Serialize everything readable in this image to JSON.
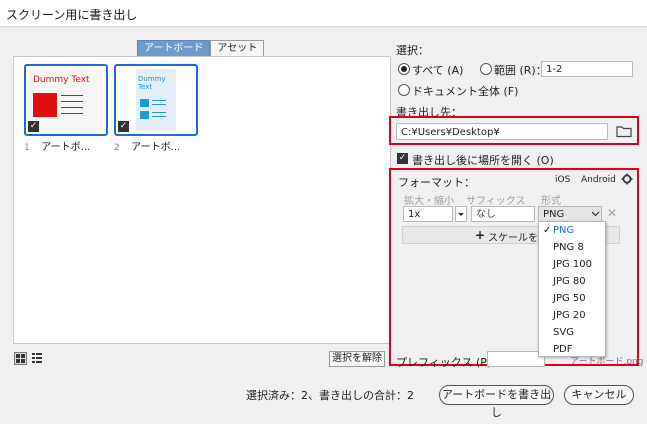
{
  "window": {
    "title": "スクリーン用に書き出し"
  },
  "tabs": [
    {
      "label": "アートボード"
    },
    {
      "label": "アセット"
    }
  ],
  "artboards": [
    {
      "num": "1",
      "label": "アートボ...",
      "thumb_text": "Dummy Text"
    },
    {
      "num": "2",
      "label": "アートボ...",
      "thumb_text": "Dummy Text"
    }
  ],
  "selection": {
    "label": "選択：",
    "all": "すべて (A)",
    "range": "範囲 (R)：",
    "range_value": "1-2",
    "whole_doc": "ドキュメント全体 (F)"
  },
  "export_to": {
    "label": "書き出し先：",
    "path": "C:¥Users¥Desktop¥",
    "open_after": "書き出し後に場所を開く (O)"
  },
  "format": {
    "label": "フォーマット：",
    "ios": "iOS",
    "android": "Android",
    "col_scale": "拡大・縮小",
    "col_suffix": "サフィックス",
    "col_format": "形式",
    "scale_value": "1x",
    "suffix_value": "なし",
    "format_value": "PNG",
    "add_scale": "スケールを追加"
  },
  "format_menu": {
    "items": [
      "PNG",
      "PNG 8",
      "JPG 100",
      "JPG 80",
      "JPG 50",
      "JPG 20",
      "SVG",
      "PDF"
    ],
    "selected": "PNG"
  },
  "prefix": {
    "label": "プレフィックス (P)：",
    "example": "アートボード.png"
  },
  "footer": {
    "deselect": "選択を解除",
    "status": "選択済み：2、書き出しの合計：2",
    "export_btn": "アートボードを書き出し",
    "cancel_btn": "キャンセル"
  },
  "colors": {
    "accent": "#1e6ad8",
    "highlight": "#e0001b",
    "tab_active": "#6b9bd1"
  }
}
